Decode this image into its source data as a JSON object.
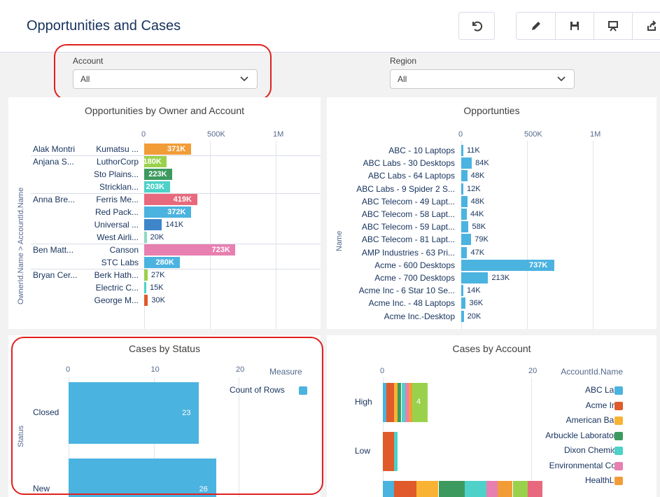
{
  "header": {
    "title": "Opportunities and Cases"
  },
  "toolbar": {
    "undo_icon": "undo-icon",
    "edit_icon": "pencil-icon",
    "save_icon": "save-icon",
    "present_icon": "presentation-icon",
    "share_icon": "share-icon"
  },
  "filters": {
    "account": {
      "label": "Account",
      "value": "All"
    },
    "region": {
      "label": "Region",
      "value": "All"
    }
  },
  "colors": {
    "highlight": "#e02020",
    "primary_bar": "#4bb3e0"
  },
  "chart_data": [
    {
      "type": "bar",
      "title": "Opportunities by Owner and Account",
      "ylabel": "OwnerId.Name > AccountId.Name",
      "xticks": [
        "0",
        "500K",
        "1M"
      ],
      "xlim": [
        0,
        1000000
      ],
      "groups": [
        {
          "owner": "Alak Montri",
          "rows": [
            {
              "account": "Kumatsu ...",
              "value": 371000,
              "label": "371K",
              "color": "#f29c38"
            }
          ]
        },
        {
          "owner": "Anjana S...",
          "rows": [
            {
              "account": "LuthorCorp",
              "value": 180000,
              "label": "180K",
              "color": "#9ad14b"
            },
            {
              "account": "Sto Plains...",
              "value": 223000,
              "label": "223K",
              "color": "#3d9a5f"
            },
            {
              "account": "Stricklan...",
              "value": 203000,
              "label": "203K",
              "color": "#4dd1c8"
            }
          ]
        },
        {
          "owner": "Anna Bre...",
          "rows": [
            {
              "account": "Ferris Me...",
              "value": 419000,
              "label": "419K",
              "color": "#e8697d"
            },
            {
              "account": "Red Pack...",
              "value": 372000,
              "label": "372K",
              "color": "#4bb3e0"
            },
            {
              "account": "Universal ...",
              "value": 141000,
              "label": "141K",
              "color": "#3e86c9"
            },
            {
              "account": "West Airli...",
              "value": 20000,
              "label": "20K",
              "color": "#8fd9c4"
            }
          ]
        },
        {
          "owner": "Ben Matt...",
          "rows": [
            {
              "account": "Canson",
              "value": 723000,
              "label": "723K",
              "color": "#e77fb0"
            },
            {
              "account": "STC Labs",
              "value": 280000,
              "label": "280K",
              "color": "#4bb3e0"
            }
          ]
        },
        {
          "owner": "Bryan Cer...",
          "rows": [
            {
              "account": "Berk Hath...",
              "value": 27000,
              "label": "27K",
              "color": "#9ad14b"
            },
            {
              "account": "Electric C...",
              "value": 15000,
              "label": "15K",
              "color": "#4dd1c8"
            },
            {
              "account": "George M...",
              "value": 30000,
              "label": "30K",
              "color": "#e05a2b"
            }
          ]
        }
      ]
    },
    {
      "type": "bar",
      "title": "Opportunties",
      "ylabel": "Name",
      "xticks": [
        "0",
        "500K",
        "1M"
      ],
      "xlim": [
        0,
        1000000
      ],
      "categories": [
        "ABC - 10 Laptops",
        "ABC Labs - 30 Desktops",
        "ABC Labs - 64 Laptops",
        "ABC Labs - 9 Spider 2 S...",
        "ABC Telecom - 49 Lapt...",
        "ABC Telecom - 58 Lapt...",
        "ABC Telecom - 59 Lapt...",
        "ABC Telecom - 81 Lapt...",
        "AMP Industries - 63 Pri...",
        "Acme - 600 Desktops",
        "Acme - 700 Desktops",
        "Acme Inc - 6 Star 10 Se...",
        "Acme Inc. - 48 Laptops",
        "Acme Inc.-Desktop"
      ],
      "values": [
        11000,
        84000,
        48000,
        12000,
        48000,
        44000,
        58000,
        79000,
        47000,
        737000,
        213000,
        14000,
        36000,
        20000
      ],
      "labels": [
        "11K",
        "84K",
        "48K",
        "12K",
        "48K",
        "44K",
        "58K",
        "79K",
        "47K",
        "737K",
        "213K",
        "14K",
        "36K",
        "20K"
      ]
    },
    {
      "type": "bar",
      "title": "Cases by Status",
      "ylabel": "Status",
      "xticks": [
        "0",
        "10",
        "20"
      ],
      "xlim": [
        0,
        30
      ],
      "categories": [
        "Closed",
        "New"
      ],
      "series": [
        {
          "name": "Count of Rows",
          "values": [
            23,
            26
          ]
        }
      ],
      "legend_title": "Measure",
      "legend_position": "top-right"
    },
    {
      "type": "bar",
      "stacked": true,
      "title": "Cases by Account",
      "xticks": [
        "0",
        "20"
      ],
      "xlim": [
        0,
        40
      ],
      "categories": [
        "High",
        "Low"
      ],
      "segments": [
        [
          1,
          2,
          1,
          1,
          1,
          1,
          1,
          4
        ],
        [
          3,
          1
        ]
      ],
      "visible_labels": {
        "High": "4"
      },
      "legend_title": "AccountId.Name",
      "legend": [
        {
          "name": "ABC Labs",
          "color": "#4bb3e0"
        },
        {
          "name": "Acme Inc.",
          "color": "#e05a2b"
        },
        {
          "name": "American Bank",
          "color": "#f9b233"
        },
        {
          "name": "Arbuckle Laborator...",
          "color": "#3d9a5f"
        },
        {
          "name": "Dixon Chemical",
          "color": "#4dd1c8"
        },
        {
          "name": "Environmental Co...",
          "color": "#e77fb0"
        },
        {
          "name": "HealthLife",
          "color": "#f29c38"
        }
      ]
    }
  ]
}
